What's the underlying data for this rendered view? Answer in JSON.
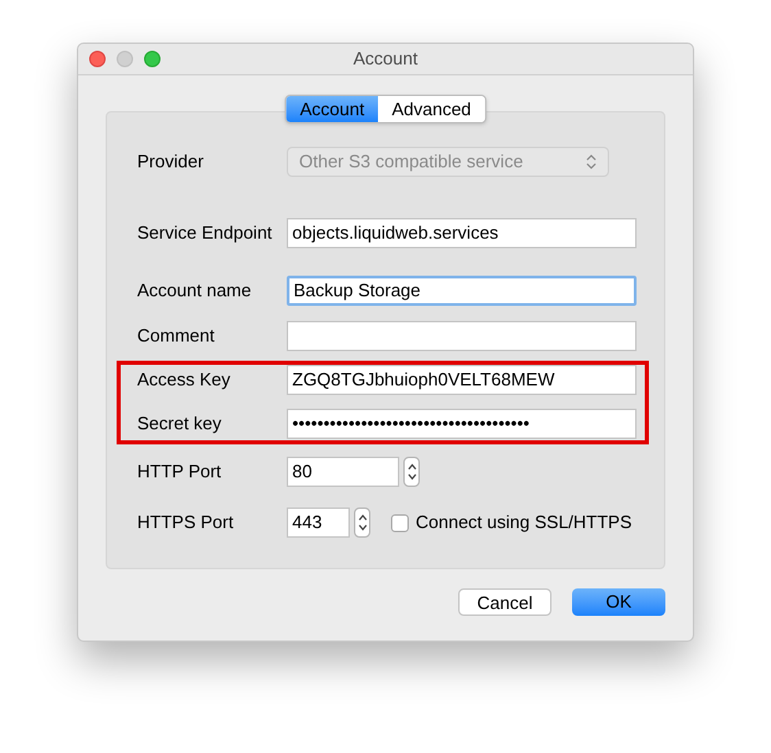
{
  "window": {
    "title": "Account"
  },
  "tabs": [
    {
      "label": "Account",
      "selected": true
    },
    {
      "label": "Advanced",
      "selected": false
    }
  ],
  "fields": [
    {
      "kind": "select",
      "label": "Provider",
      "value": "Other S3 compatible service",
      "disabled": true
    },
    {
      "kind": "text",
      "label": "Service Endpoint",
      "value": "objects.liquidweb.services",
      "focused": false
    },
    {
      "kind": "text",
      "label": "Account name",
      "value": "Backup Storage",
      "focused": true
    },
    {
      "kind": "text",
      "label": "Comment",
      "focused": false
    },
    {
      "kind": "text",
      "label": "Access Key",
      "value": "ZGQ8TGJbhuioph0VELT68MEW",
      "focused": false,
      "highlighted": true
    },
    {
      "kind": "password",
      "label": "Secret key",
      "value": "••••••••••••••••••••••••••••••••••••••",
      "focused": false,
      "highlighted": true
    },
    {
      "kind": "port",
      "label": "HTTP Port",
      "value": "80",
      "focused": false
    },
    {
      "kind": "port_check",
      "label": "HTTPS Port",
      "value": "443",
      "focused": false,
      "checkbox": {
        "label": "Connect using SSL/HTTPS",
        "checked": false
      }
    }
  ],
  "buttons": [
    {
      "label": "Cancel",
      "default": false
    },
    {
      "label": "OK",
      "default": true
    }
  ]
}
